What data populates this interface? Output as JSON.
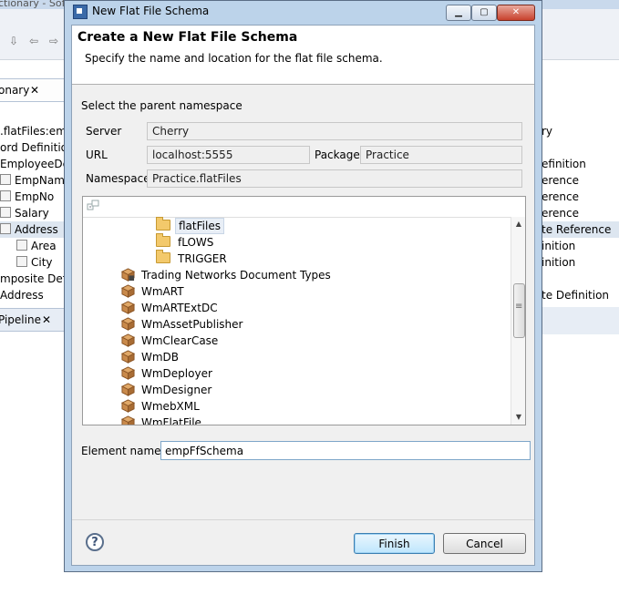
{
  "background": {
    "window_title": "ctionary - Sof",
    "left_tab": "onary",
    "left_rows": [
      ".flatFiles:emp",
      "ord Definition",
      "EmployeeDet",
      "EmpNam",
      "EmpNo",
      "Salary",
      "Address",
      "Area",
      "City",
      "mposite Defin",
      "Address"
    ],
    "pipeline_tab": "Pipeline",
    "right_rows": [
      "ry",
      "",
      "efinition",
      "erence",
      "erence",
      "erence",
      "te Reference",
      "inition",
      "inition",
      "",
      "te Definition"
    ]
  },
  "dialog": {
    "title": "New Flat File Schema",
    "header_title": "Create a New Flat File Schema",
    "header_desc": "Specify the name and location for the flat file schema.",
    "section_label": "Select the parent namespace",
    "server_label": "Server",
    "server_value": "Cherry",
    "url_label": "URL",
    "url_value": "localhost:5555",
    "package_label": "Package",
    "package_value": "Practice",
    "namespace_label": "Namespace",
    "namespace_value": "Practice.flatFiles",
    "tree": {
      "folders": [
        "flatFiles",
        "fLOWS",
        "TRIGGER"
      ],
      "packages": [
        "Trading Networks Document Types",
        "WmART",
        "WmARTExtDC",
        "WmAssetPublisher",
        "WmClearCase",
        "WmDB",
        "WmDeployer",
        "WmDesigner",
        "WmebXML",
        "WmFlatFile"
      ]
    },
    "element_label": "Element name",
    "element_value": "empFfSchema",
    "finish_label": "Finish",
    "cancel_label": "Cancel"
  },
  "colors": {
    "dialog_frame": "#bcd3ea",
    "folder": "#f3c96b",
    "package": "#c98a4b",
    "close_button": "#c8412c"
  }
}
